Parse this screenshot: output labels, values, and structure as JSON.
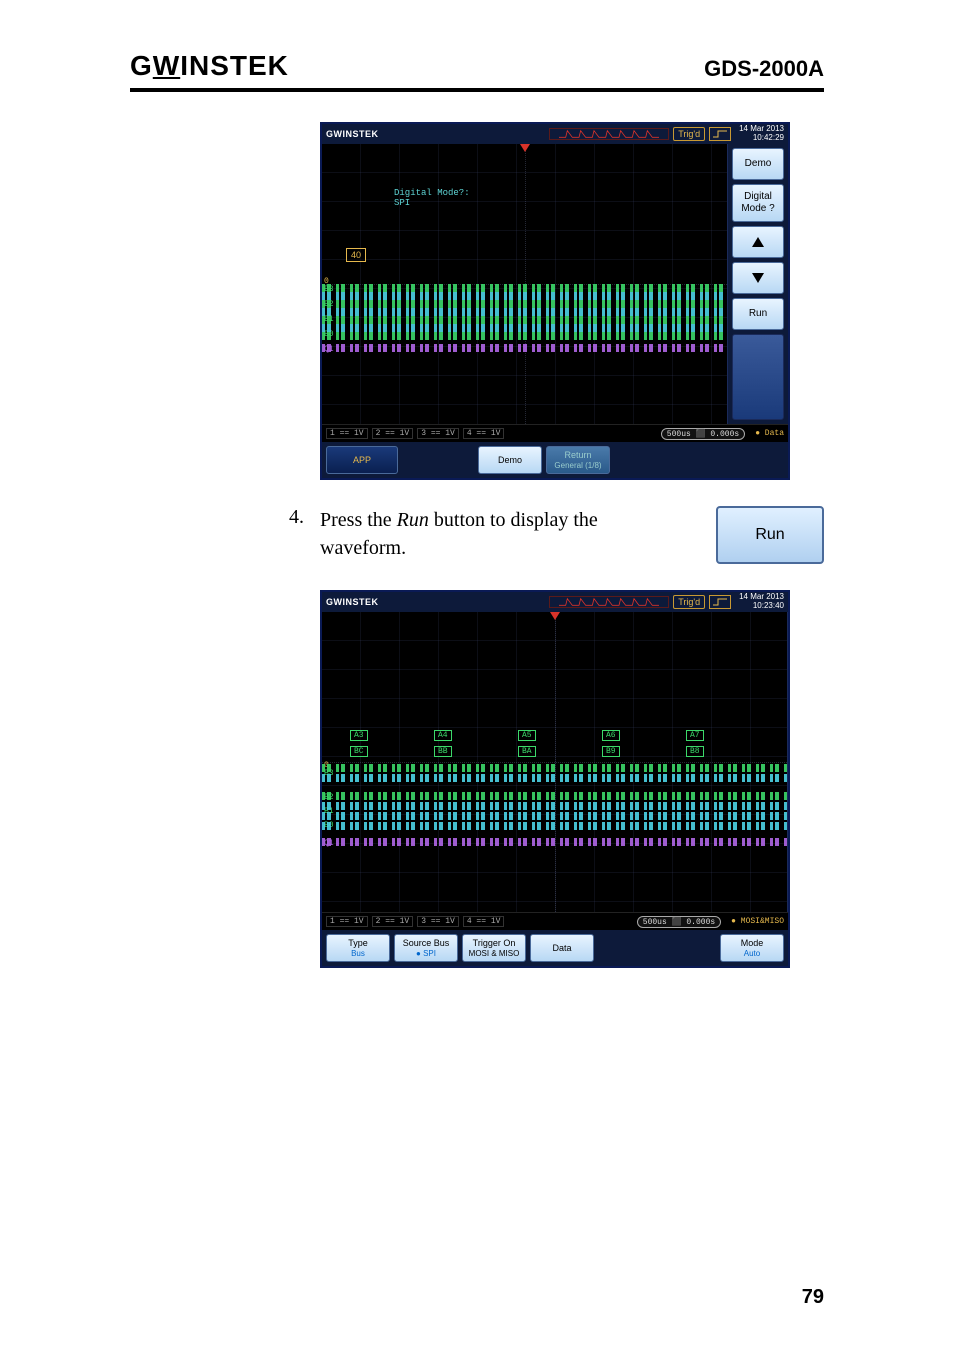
{
  "header": {
    "brand": "GWINSTEK",
    "model": "GDS-2000A"
  },
  "step": {
    "num": "4.",
    "text_prefix": "Press the ",
    "text_em": "Run",
    "text_suffix": " button to display the waveform.",
    "run_label": "Run"
  },
  "page_number": "79",
  "osc1": {
    "logo": "GWINSTEK",
    "trigd": "Trig'd",
    "date": "14 Mar 2013",
    "time": "10:42:29",
    "overlay_label1": "Digital Mode?:",
    "overlay_label2": "SPI",
    "marker_40": "40",
    "timebase": "500us",
    "tpos": "0.000s",
    "ext_label": "Data",
    "side": {
      "demo": "Demo",
      "digital": "Digital",
      "mode": "Mode ?",
      "run": "Run"
    },
    "bottom": {
      "app": "APP",
      "demo": "Demo",
      "return": "Return",
      "return_sub": "General (1/8)"
    },
    "ch_center": "0",
    "ch_tags": [
      "B3",
      "B2",
      "B1",
      "B0"
    ],
    "ch_q": "Q1"
  },
  "osc2": {
    "logo": "GWINSTEK",
    "trigd": "Trig'd",
    "date": "14 Mar 2013",
    "time": "10:23:40",
    "data_tags_row1": [
      "A3",
      "A4",
      "A5",
      "A6",
      "A7"
    ],
    "data_tags_row2": [
      "BC",
      "BB",
      "BA",
      "B9",
      "B8"
    ],
    "timebase": "500us",
    "tpos": "0.000s",
    "ext_label": "MOSI&MISO",
    "ch_center": "0",
    "ch_tags": [
      "B3",
      "B2",
      "B1",
      "B0"
    ],
    "ch_q": "Q1",
    "bottom": {
      "type": "Type",
      "type_val": "Bus",
      "src": "Source Bus",
      "src_val": "SPI",
      "trg": "Trigger On",
      "trg_val": "MOSI & MISO",
      "data": "Data",
      "mode": "Mode",
      "mode_val": "Auto"
    }
  }
}
